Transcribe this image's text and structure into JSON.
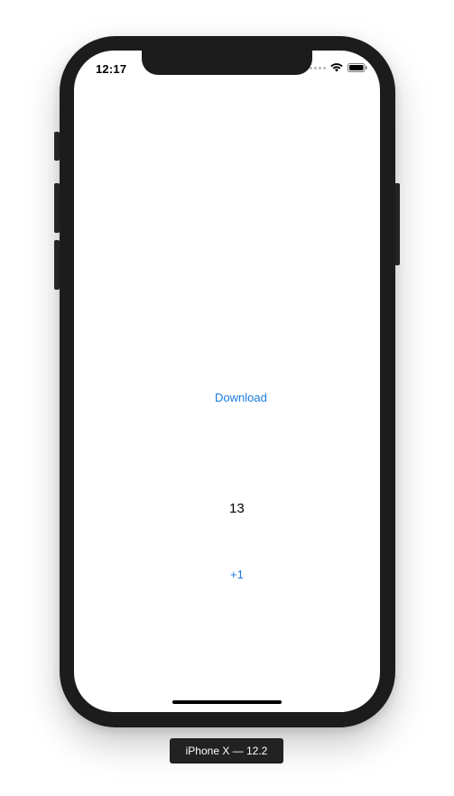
{
  "status_bar": {
    "time": "12:17",
    "icons": [
      "signal-dots-icon",
      "wifi-icon",
      "battery-icon"
    ]
  },
  "content": {
    "download_label": "Download",
    "counter_value": "13",
    "increment_label": "+1"
  },
  "simulator": {
    "device_label": "iPhone X — 12.2"
  },
  "colors": {
    "accent": "#1a7be0",
    "frame": "#1c1c1c",
    "screen": "#ffffff",
    "text": "#000000"
  }
}
